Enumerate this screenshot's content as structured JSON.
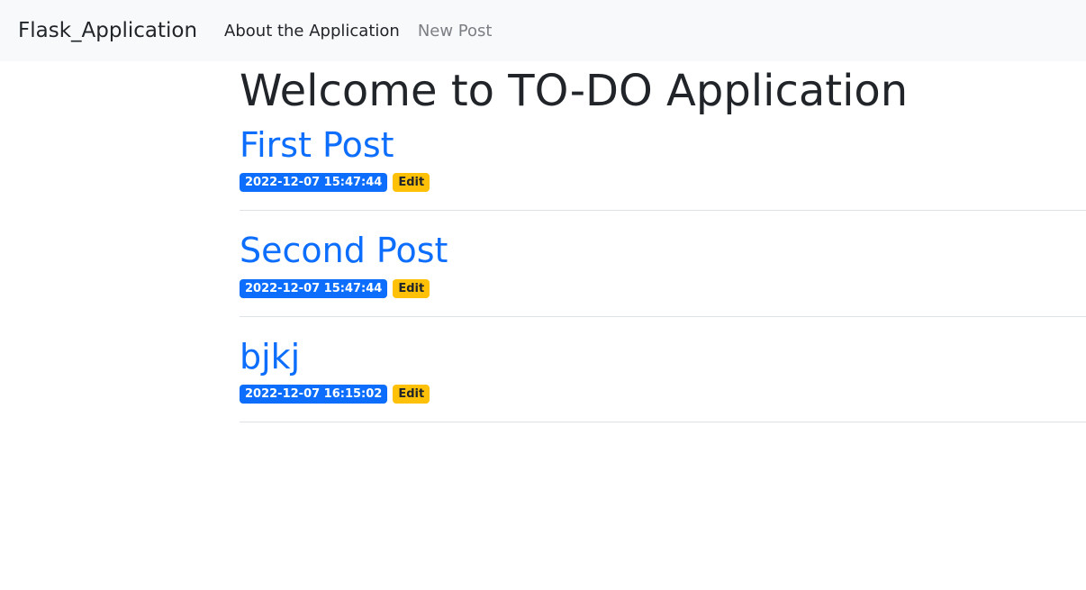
{
  "navbar": {
    "brand": "Flask_Application",
    "links": [
      {
        "label": "About the Application"
      },
      {
        "label": "New Post"
      }
    ]
  },
  "main": {
    "title": "Welcome to TO-DO Application",
    "posts": [
      {
        "title": "First Post",
        "date": "2022-12-07 15:47:44",
        "edit_label": "Edit"
      },
      {
        "title": "Second Post",
        "date": "2022-12-07 15:47:44",
        "edit_label": "Edit"
      },
      {
        "title": "bjkj",
        "date": "2022-12-07 16:15:02",
        "edit_label": "Edit"
      }
    ]
  },
  "colors": {
    "navbar_bg": "#f8f9fa",
    "link_primary": "#0d6efd",
    "badge_warning": "#ffc107",
    "text_dark": "#212529",
    "text_muted": "#7b7f84"
  }
}
